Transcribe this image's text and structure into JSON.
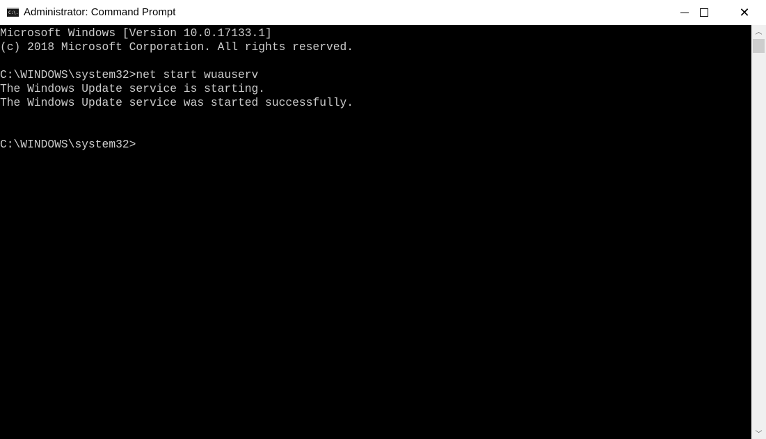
{
  "window": {
    "title": "Administrator: Command Prompt",
    "icon": "cmd-icon",
    "icon_text": "C:\\.",
    "controls": {
      "minimize": "minimize-icon",
      "maximize": "maximize-icon",
      "close": "close-icon",
      "close_glyph": "✕"
    }
  },
  "console": {
    "background": "#000000",
    "foreground": "#cccccc",
    "lines": [
      "Microsoft Windows [Version 10.0.17133.1]",
      "(c) 2018 Microsoft Corporation. All rights reserved.",
      "",
      "C:\\WINDOWS\\system32>net start wuauserv",
      "The Windows Update service is starting.",
      "The Windows Update service was started successfully.",
      "",
      "",
      "C:\\WINDOWS\\system32>"
    ]
  },
  "scrollbar": {
    "up_glyph": "︿",
    "down_glyph": "﹀"
  }
}
